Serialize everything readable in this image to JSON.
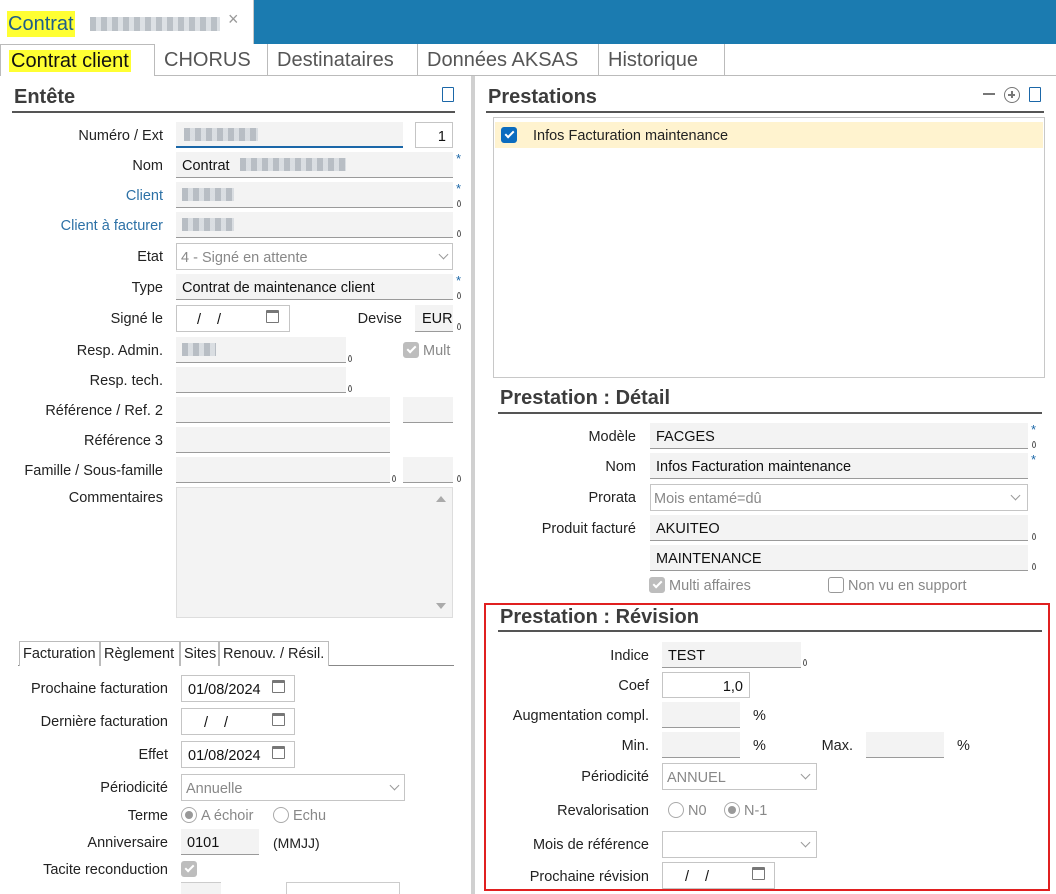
{
  "window": {
    "title": "Contrat",
    "close": "×"
  },
  "tabs": [
    "Contrat client",
    "CHORUS",
    "Destinataires",
    "Données AKSAS",
    "Historique"
  ],
  "entete": {
    "title": "Entête",
    "numero_label": "Numéro / Ext",
    "ext_value": "1",
    "nom_label": "Nom",
    "nom_value": "Contrat",
    "client_label": "Client",
    "client_facturer_label": "Client à facturer",
    "etat_label": "Etat",
    "etat_value": "4 - Signé en attente",
    "type_label": "Type",
    "type_value": "Contrat de maintenance client",
    "signe_label": "Signé le",
    "signe_value": "/ /",
    "devise_label": "Devise",
    "devise_value": "EUR",
    "resp_admin_label": "Resp. Admin.",
    "mult_label": "Mult",
    "resp_tech_label": "Resp. tech.",
    "reference_label": "Référence / Ref. 2",
    "reference3_label": "Référence 3",
    "famille_label": "Famille / Sous-famille",
    "commentaires_label": "Commentaires"
  },
  "subtabs": [
    "Facturation",
    "Règlement",
    "Sites",
    "Renouv. / Résil."
  ],
  "facturation": {
    "prochaine_label": "Prochaine facturation",
    "prochaine_value": "01/08/2024",
    "derniere_label": "Dernière facturation",
    "derniere_value": "/ /",
    "effet_label": "Effet",
    "effet_value": "01/08/2024",
    "periodicite_label": "Périodicité",
    "periodicite_value": "Annuelle",
    "terme_label": "Terme",
    "terme_opt1": "A échoir",
    "terme_opt2": "Echu",
    "anniversaire_label": "Anniversaire",
    "anniversaire_value": "0101",
    "anniversaire_hint": "(MMJJ)",
    "tacite_label": "Tacite reconduction"
  },
  "prestations": {
    "title": "Prestations",
    "items": [
      "Infos Facturation maintenance"
    ]
  },
  "detail": {
    "title": "Prestation : Détail",
    "modele_label": "Modèle",
    "modele_value": "FACGES",
    "nom_label": "Nom",
    "nom_value": "Infos Facturation maintenance",
    "prorata_label": "Prorata",
    "prorata_value": "Mois entamé=dû",
    "produit_label": "Produit facturé",
    "produit_value1": "AKUITEO",
    "produit_value2": "MAINTENANCE",
    "multi_label": "Multi affaires",
    "nonvu_label": "Non vu en support"
  },
  "revision": {
    "title": "Prestation : Révision",
    "indice_label": "Indice",
    "indice_value": "TEST",
    "coef_label": "Coef",
    "coef_value": "1,0",
    "augmentation_label": "Augmentation compl.",
    "pct": "%",
    "min_label": "Min.",
    "max_label": "Max.",
    "periodicite_label": "Périodicité",
    "periodicite_value": "ANNUEL",
    "revalorisation_label": "Revalorisation",
    "n0": "N0",
    "n1": "N-1",
    "mois_ref_label": "Mois de référence",
    "prochaine_label": "Prochaine révision",
    "prochaine_value": "/ /"
  },
  "colors": {
    "titlebar": "#1b7bb0",
    "highlight": "#ffff33",
    "selection": "#fff3cf",
    "revision_border": "#e02020"
  }
}
